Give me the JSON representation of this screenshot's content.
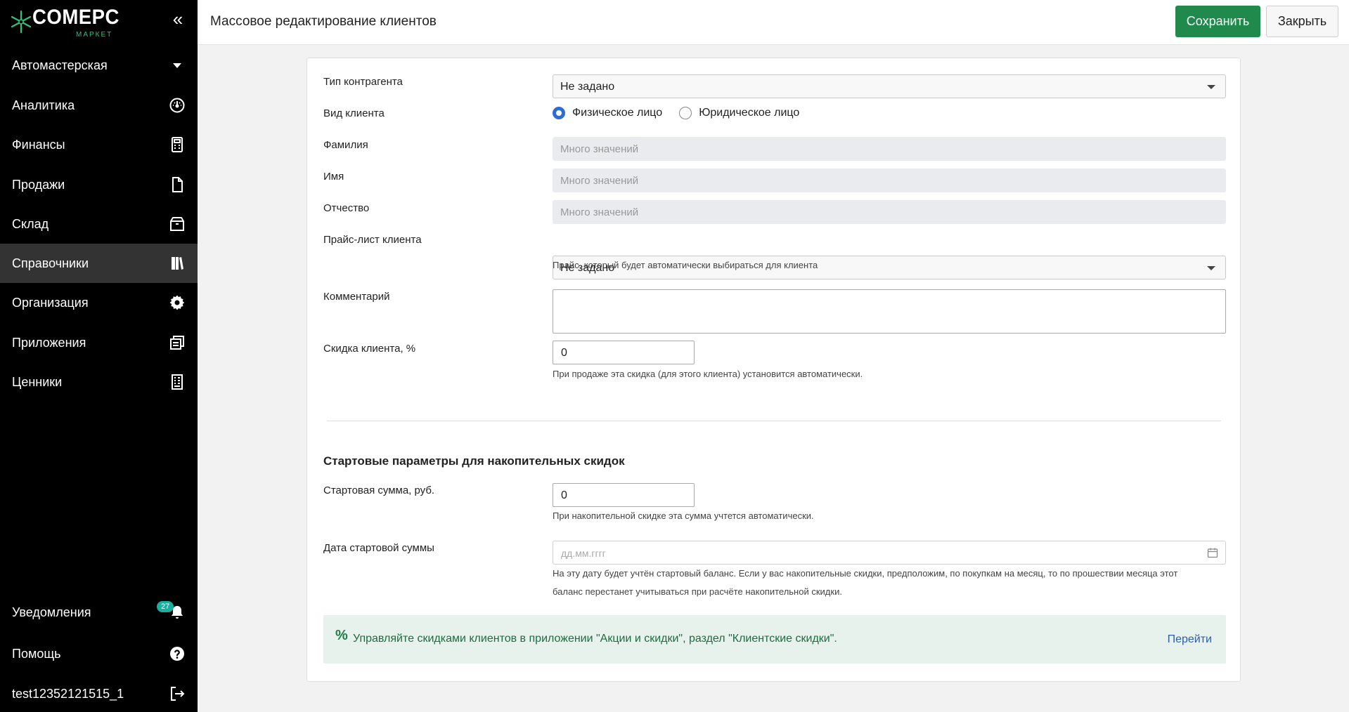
{
  "brand": {
    "name": "COMEPC",
    "sub": "МАРКЕТ",
    "accent": "#2ec27e"
  },
  "sidebar": {
    "store": "Автомастерская",
    "items": [
      {
        "label": "Аналитика",
        "icon": "gauge-icon"
      },
      {
        "label": "Финансы",
        "icon": "calculator-icon"
      },
      {
        "label": "Продажи",
        "icon": "document-icon"
      },
      {
        "label": "Склад",
        "icon": "box-icon"
      },
      {
        "label": "Справочники",
        "icon": "books-icon",
        "active": true
      },
      {
        "label": "Организация",
        "icon": "gear-icon"
      },
      {
        "label": "Приложения",
        "icon": "windows-icon"
      },
      {
        "label": "Ценники",
        "icon": "price-tag-icon"
      }
    ],
    "notifications": {
      "label": "Уведомления",
      "count": "27"
    },
    "help": "Помощь",
    "user": "test12352121515_1"
  },
  "header": {
    "title": "Массовое редактирование клиентов",
    "save_label": "Сохранить",
    "close_label": "Закрыть"
  },
  "form": {
    "counterparty_type": {
      "label": "Тип контрагента",
      "value": "Не задано"
    },
    "client_kind": {
      "label": "Вид клиента",
      "option1": "Физическое лицо",
      "option2": "Юридическое лицо",
      "selected": "Физическое лицо"
    },
    "last_name": {
      "label": "Фамилия",
      "placeholder": "Много значений"
    },
    "first_name": {
      "label": "Имя",
      "placeholder": "Много значений"
    },
    "middle_name": {
      "label": "Отчество",
      "placeholder": "Много значений"
    },
    "price_list": {
      "label": "Прайс-лист клиента",
      "value": "Не задано",
      "help": "Прайс, который будет автоматически выбираться для клиента"
    },
    "comment": {
      "label": "Комментарий",
      "value": ""
    },
    "discount": {
      "label": "Скидка клиента, %",
      "value": "0",
      "help": "При продаже эта скидка (для этого клиента) установится автоматически."
    },
    "section_title": "Стартовые параметры для накопительных скидок",
    "start_sum": {
      "label": "Стартовая сумма, руб.",
      "value": "0",
      "help": "При накопительной скидке эта сумма учтется автоматически."
    },
    "start_date": {
      "label": "Дата стартовой суммы",
      "placeholder": "дд.мм.гггг",
      "help1": "На эту дату будет учтён стартовый баланс. Если у вас накопительные скидки, предположим, по покупкам на месяц, то по прошествии месяца этот",
      "help2": "баланс перестанет учитываться при расчёте накопительной скидки."
    },
    "promo": {
      "text": "Управляйте скидками клиентов в приложении \"Акции и скидки\", раздел \"Клиентские скидки\".",
      "link": "Перейти"
    }
  }
}
